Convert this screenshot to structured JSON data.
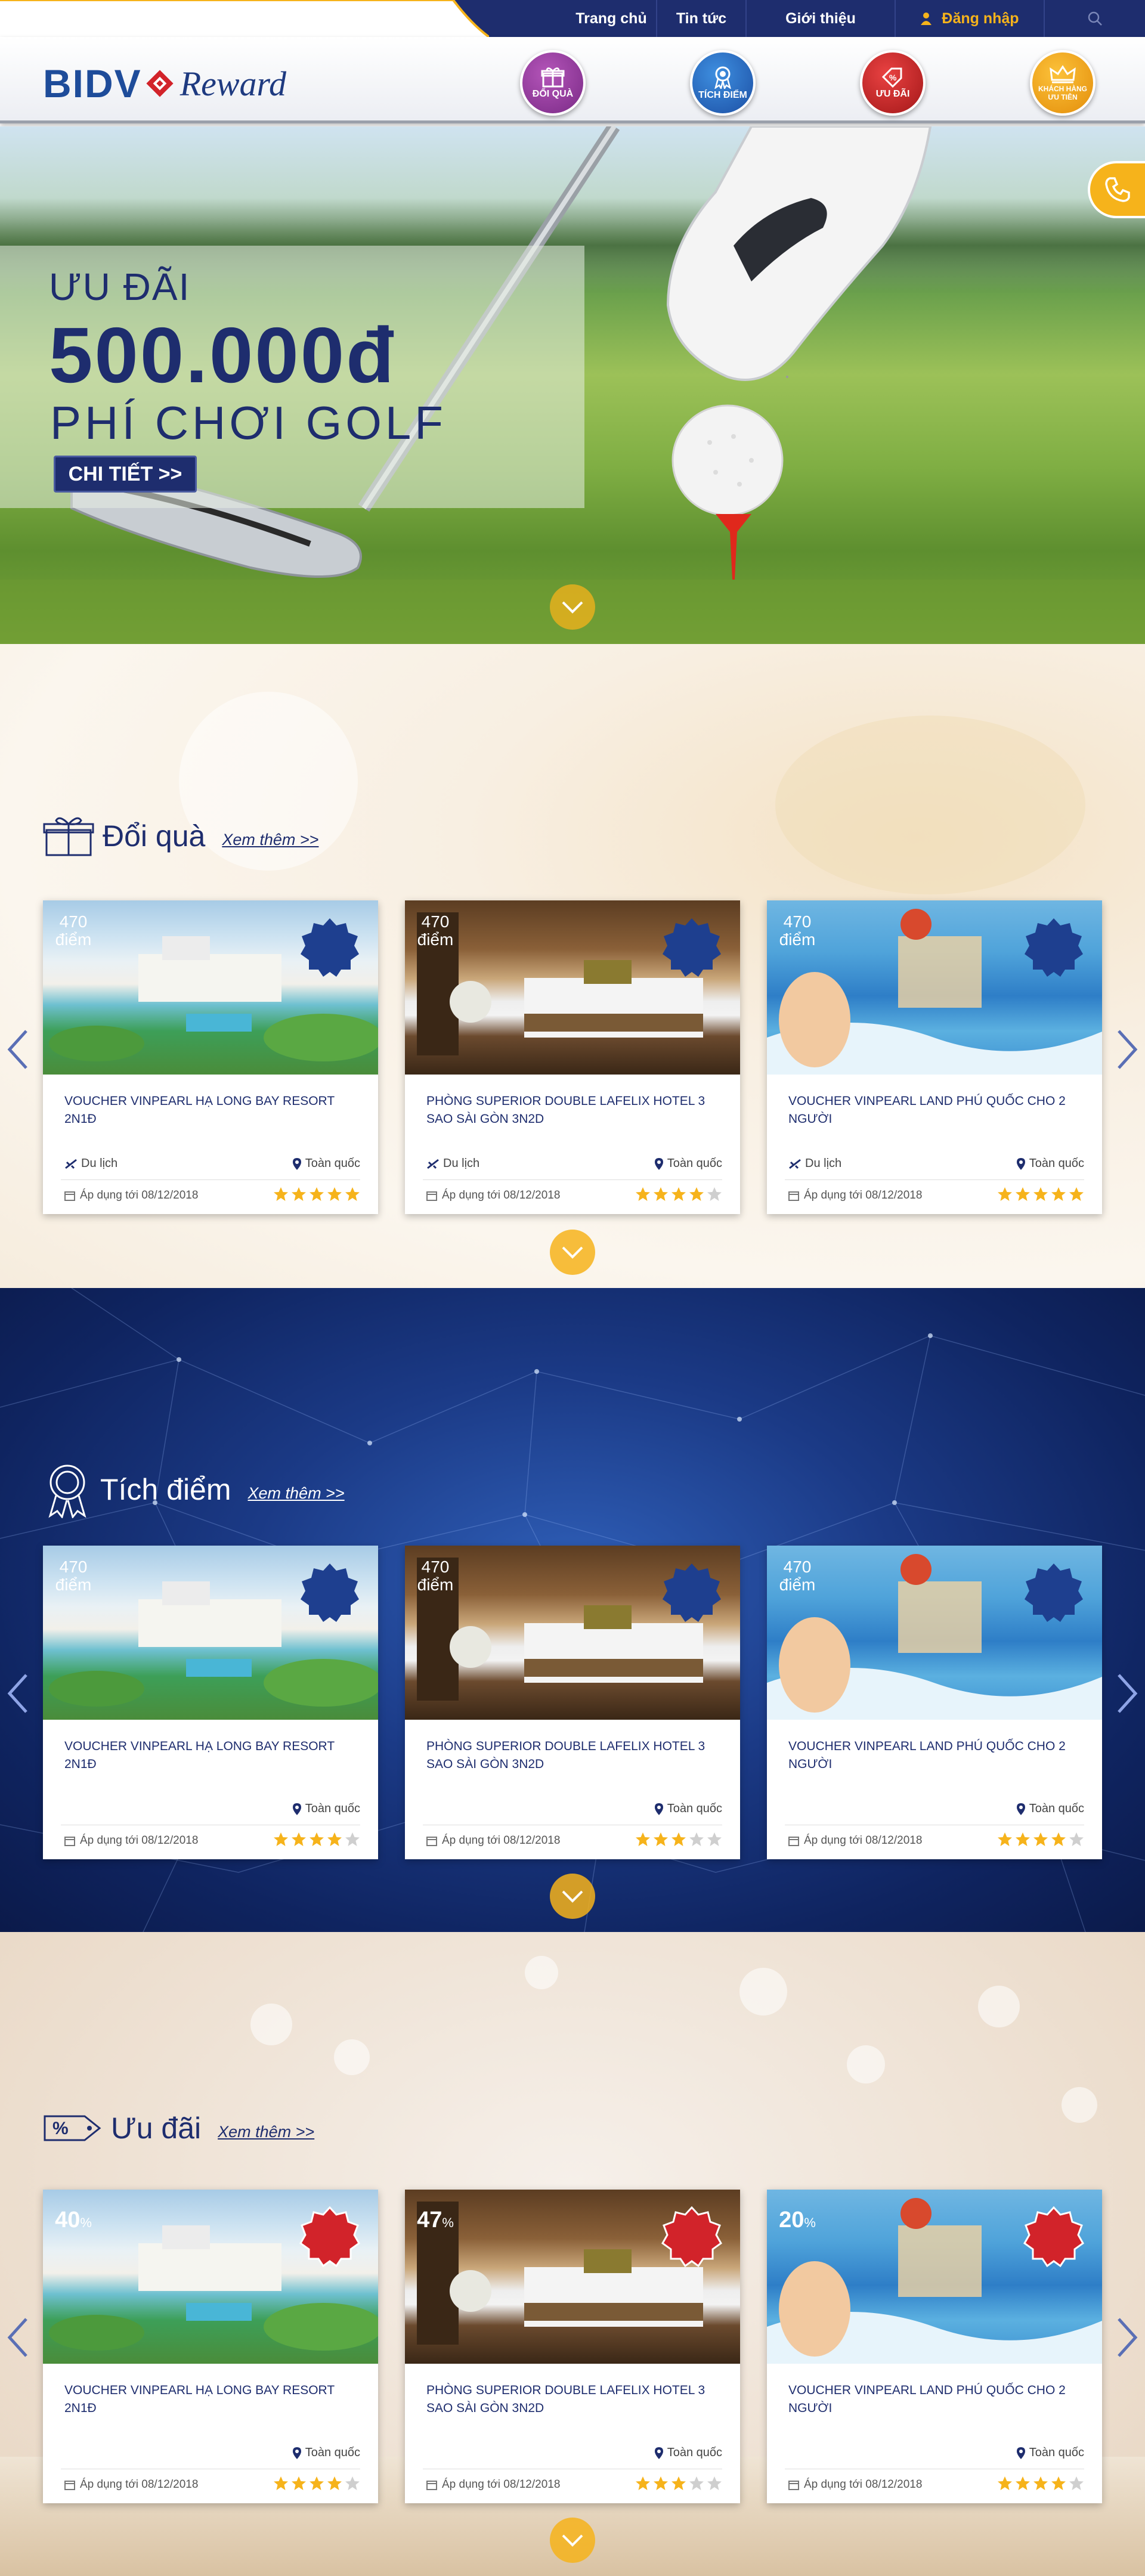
{
  "header": {
    "nav": [
      "Trang chủ",
      "Tin tức",
      "Giới thiệu"
    ],
    "login_label": "Đăng nhập",
    "logo_left": "BIDV",
    "logo_right": "Reward",
    "categories": [
      {
        "label": "ĐỔI QUÀ",
        "color": "#8e3a98"
      },
      {
        "label": "TÍCH ĐIỂM",
        "color": "#2a66bf"
      },
      {
        "label": "ƯU ĐÃI",
        "color": "#c42224"
      },
      {
        "label": "KHÁCH HÀNG ƯU TIÊN",
        "color": "#f4a718"
      }
    ]
  },
  "hero": {
    "line1": "ƯU ĐÃI",
    "line2": "500.000đ",
    "line3": "PHÍ CHƠI GOLF",
    "cta": "CHI TIẾT >>"
  },
  "sections": {
    "gift": {
      "title": "Đổi quà",
      "more": "Xem thêm >>",
      "cards": [
        {
          "title": "VOUCHER VINPEARL HẠ LONG BAY RESORT 2N1Đ",
          "badge": "470",
          "badge_unit": "điểm",
          "category": "Du lịch",
          "location": "Toàn quốc",
          "date": "Áp dụng tới 08/12/2018",
          "rating": 5
        },
        {
          "title": "PHÒNG SUPERIOR DOUBLE LAFELIX HOTEL 3 SAO SÀI GÒN 3N2D",
          "badge": "470",
          "badge_unit": "điểm",
          "category": "Du lịch",
          "location": "Toàn quốc",
          "date": "Áp dụng tới 08/12/2018",
          "rating": 4
        },
        {
          "title": "VOUCHER VINPEARL LAND PHÚ QUỐC CHO 2 NGƯỜI",
          "badge": "470",
          "badge_unit": "điểm",
          "category": "Du lịch",
          "location": "Toàn quốc",
          "date": "Áp dụng tới 08/12/2018",
          "rating": 5
        }
      ]
    },
    "points": {
      "title": "Tích điểm",
      "more": "Xem thêm >>",
      "cards": [
        {
          "title": "VOUCHER VINPEARL HẠ LONG BAY RESORT 2N1Đ",
          "badge": "470",
          "badge_unit": "điểm",
          "location": "Toàn quốc",
          "date": "Áp dụng tới 08/12/2018",
          "rating": 4
        },
        {
          "title": "PHÒNG SUPERIOR DOUBLE LAFELIX HOTEL 3 SAO SÀI GÒN 3N2D",
          "badge": "470",
          "badge_unit": "điểm",
          "location": "Toàn quốc",
          "date": "Áp dụng tới 08/12/2018",
          "rating": 3
        },
        {
          "title": "VOUCHER VINPEARL LAND PHÚ QUỐC CHO 2 NGƯỜI",
          "badge": "470",
          "badge_unit": "điểm",
          "location": "Toàn quốc",
          "date": "Áp dụng tới 08/12/2018",
          "rating": 4
        }
      ]
    },
    "deals": {
      "title": "Ưu đãi",
      "more": "Xem thêm >>",
      "tag": "%",
      "cards": [
        {
          "title": "VOUCHER VINPEARL HẠ LONG BAY RESORT 2N1Đ",
          "badge": "40",
          "badge_unit": "%",
          "location": "Toàn quốc",
          "date": "Áp dụng tới 08/12/2018",
          "rating": 4
        },
        {
          "title": "PHÒNG SUPERIOR DOUBLE LAFELIX HOTEL 3 SAO SÀI GÒN 3N2D",
          "badge": "47",
          "badge_unit": "%",
          "location": "Toàn quốc",
          "date": "Áp dụng tới 08/12/2018",
          "rating": 3
        },
        {
          "title": "VOUCHER VINPEARL LAND PHÚ QUỐC CHO 2 NGƯỜI",
          "badge": "20",
          "badge_unit": "%",
          "location": "Toàn quốc",
          "date": "Áp dụng tới 08/12/2018",
          "rating": 4
        }
      ]
    }
  },
  "colors": {
    "navy": "#1e2d6e",
    "gold": "#f6b31b",
    "badge_blue": "#1e3f8f",
    "badge_red": "#d2232a",
    "star_on": "#f6b31b",
    "star_off": "#cfcfcf"
  },
  "icons": {
    "user": "user-icon",
    "search": "search-icon",
    "phone": "phone-icon",
    "gift": "gift-icon",
    "medal": "medal-icon",
    "percent_tag": "percent-tag-icon",
    "plane": "plane-icon",
    "pin": "location-pin-icon",
    "calendar": "calendar-icon",
    "star": "star-icon",
    "chevron": "chevron-down-icon"
  }
}
